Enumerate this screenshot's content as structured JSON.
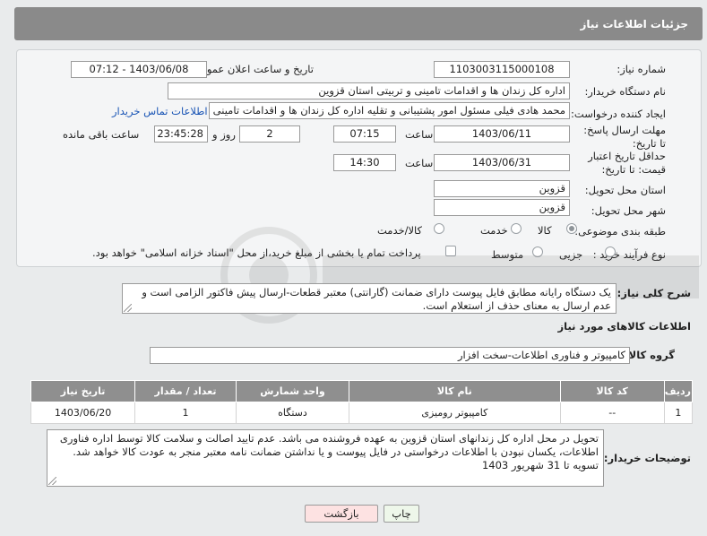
{
  "header": {
    "title": "جزئیات اطلاعات نیاز"
  },
  "fields": {
    "need_number_label": "شماره نیاز:",
    "need_number": "1103003115000108",
    "announce_label": "تاریخ و ساعت اعلان عمومی:",
    "announce_value": "1403/06/08 - 07:12",
    "buyer_org_label": "نام دستگاه خریدار:",
    "buyer_org": "اداره کل زندان ها و اقدامات تامینی و تربیتی استان قزوین",
    "creator_label": "ایجاد کننده درخواست:",
    "creator": "محمد هادی فیلی مسئول امور پشتیبانی و تقلیه اداره کل زندان ها و اقدامات تامینی",
    "contact_link": "اطلاعات تماس خریدار",
    "reply_deadline_label": "مهلت ارسال پاسخ: تا تاریخ:",
    "reply_date": "1403/06/11",
    "time_label": "ساعت",
    "reply_time": "07:15",
    "days_value": "2",
    "days_label": "روز و",
    "remaining_time": "23:45:28",
    "remaining_label": "ساعت باقی مانده",
    "price_validity_label": "حداقل تاریخ اعتبار قیمت: تا تاریخ:",
    "price_date": "1403/06/31",
    "price_time": "14:30",
    "province_label": "استان محل تحویل:",
    "province": "قزوین",
    "city_label": "شهر محل تحویل:",
    "city": "قزوین",
    "category_label": "طبقه بندی موضوعی:",
    "cat_goods": "کالا",
    "cat_service": "خدمت",
    "cat_goods_service": "کالا/خدمت",
    "process_label": "نوع فرآیند خرید :",
    "proc_small": "جزیی",
    "proc_medium": "متوسط",
    "payment_note": "پرداخت تمام یا بخشی از مبلغ خرید،از محل \"اسناد خزانه اسلامی\" خواهد بود."
  },
  "description": {
    "label": "شرح کلی نیاز:",
    "text": "یک دستگاه رایانه مطابق فایل پیوست دارای ضمانت (گارانتی) معتبر قطعات-ارسال پیش فاکتور الزامی است و عدم ارسال به معنای حذف از استعلام است."
  },
  "goods_section": {
    "title": "اطلاعات کالاهای مورد نیاز",
    "group_label": "گروه کالا:",
    "group_value": "کامپیوتر و فناوری اطلاعات-سخت افزار",
    "columns": [
      "ردیف",
      "کد کالا",
      "نام کالا",
      "واحد شمارش",
      "تعداد / مقدار",
      "تاریخ نیاز"
    ],
    "rows": [
      [
        "1",
        "--",
        "کامپیوتر رومیزی",
        "دستگاه",
        "1",
        "1403/06/20"
      ]
    ]
  },
  "buyer_notes": {
    "label": "توضیحات خریدار:",
    "text": "تحویل در محل اداره کل زندانهای استان قزوین به عهده فروشنده می باشد. عدم تایید اصالت و سلامت کالا توسط اداره فناوری اطلاعات، یکسان نبودن با اطلاعات درخواستی در فایل پیوست و یا نداشتن ضمانت نامه معتبر منجر به عودت کالا خواهد شد. تسویه تا 31 شهریور 1403"
  },
  "buttons": {
    "print": "چاپ",
    "back": "بازگشت"
  },
  "colors": {
    "header_bg": "#8a8a8a",
    "table_header_bg": "#8f8f8f",
    "link": "#1a55b5",
    "back_button_bg": "#fde2e2"
  }
}
